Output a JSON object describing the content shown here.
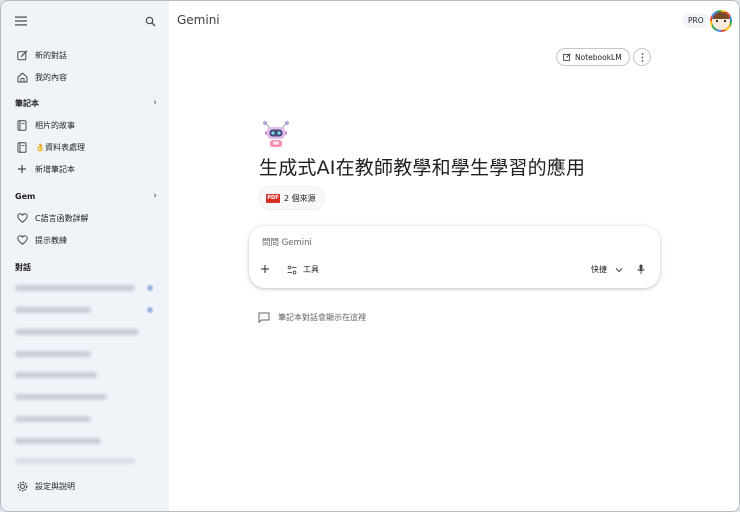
{
  "app": {
    "title": "Gemini",
    "plan_badge": "PRO"
  },
  "sidebar": {
    "top_items": [
      {
        "label": "新的對話",
        "icon": "edit-icon"
      },
      {
        "label": "我的內容",
        "icon": "home-icon"
      }
    ],
    "notebooks": {
      "heading": "筆記本",
      "items": [
        {
          "label": "相片的故事",
          "icon": "notebook-icon"
        },
        {
          "label": "👌資料表處理",
          "icon": "notebook-icon"
        },
        {
          "label": "新增筆記本",
          "icon": "plus-icon"
        }
      ]
    },
    "gems": {
      "heading": "Gem",
      "items": [
        {
          "label": "C語言函數詳解",
          "icon": "gem-icon"
        },
        {
          "label": "提示教練",
          "icon": "gem-icon"
        }
      ]
    },
    "chats": {
      "heading": "對話"
    },
    "footer": {
      "settings_label": "設定與說明",
      "icon": "gear-icon"
    }
  },
  "toolbar": {
    "notebooklm_label": "NotebookLM",
    "notebooklm_icon": "open-external-icon",
    "more_icon": "more-vertical-icon"
  },
  "notebook": {
    "title": "生成式AI在教師教學和學生學習的應用",
    "sources_label": "2 個來源",
    "source_logo_text": "PDF"
  },
  "prompt": {
    "placeholder": "問問 Gemini",
    "value": "",
    "tools_label": "工具",
    "mode_label": "快捷"
  },
  "hint": {
    "text": "筆記本對話會顯示在這裡"
  },
  "colors": {
    "sidebar_bg": "#f0f4f9",
    "main_bg": "#ffffff",
    "chat_dot": "#9fb6e6"
  }
}
